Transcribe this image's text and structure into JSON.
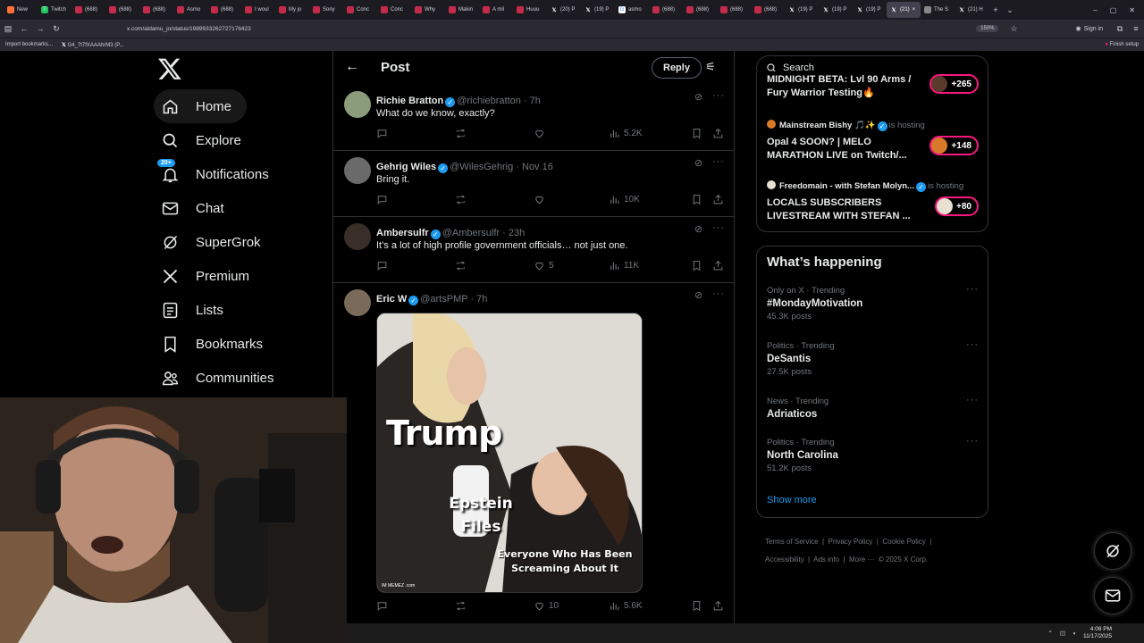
{
  "browser": {
    "tabs": [
      {
        "label": "New",
        "icon": "firefox"
      },
      {
        "label": "Twitch",
        "icon": "twitch"
      },
      {
        "label": "(688)",
        "icon": "youtube"
      },
      {
        "label": "(688)",
        "icon": "youtube"
      },
      {
        "label": "(688)",
        "icon": "youtube"
      },
      {
        "label": "Asmo",
        "icon": "youtube"
      },
      {
        "label": "(688)",
        "icon": "youtube"
      },
      {
        "label": "I woul",
        "icon": "youtube"
      },
      {
        "label": "My jo",
        "icon": "youtube"
      },
      {
        "label": "Sony",
        "icon": "youtube"
      },
      {
        "label": "Conc",
        "icon": "youtube"
      },
      {
        "label": "Conc",
        "icon": "youtube"
      },
      {
        "label": "Why",
        "icon": "youtube"
      },
      {
        "label": "Makin",
        "icon": "youtube"
      },
      {
        "label": "A mil",
        "icon": "youtube"
      },
      {
        "label": "Huuu",
        "icon": "youtube"
      },
      {
        "label": "(20) P",
        "icon": "x"
      },
      {
        "label": "(19) P",
        "icon": "x"
      },
      {
        "label": "asmo",
        "icon": "google"
      },
      {
        "label": "(688)",
        "icon": "youtube"
      },
      {
        "label": "(688)",
        "icon": "youtube"
      },
      {
        "label": "(688)",
        "icon": "youtube"
      },
      {
        "label": "(688)",
        "icon": "youtube"
      },
      {
        "label": "(19) P",
        "icon": "x"
      },
      {
        "label": "(19) P",
        "icon": "x"
      },
      {
        "label": "(19) P",
        "icon": "x"
      },
      {
        "label": "(21)",
        "icon": "x",
        "active": true
      },
      {
        "label": "The S",
        "icon": "other"
      },
      {
        "label": "(21) H",
        "icon": "x"
      }
    ],
    "url": "x.com/aldamu_jo/status/1989933262727176423",
    "zoom": "150%",
    "sign_in": "Sign in",
    "bookmarks": [
      "Import bookmarks...",
      "G4_7t7fXAAAhrM3 (P..."
    ],
    "finish_setup": "Finish setup",
    "clock_time": "4:08 PM",
    "clock_date": "11/17/2025"
  },
  "nav": {
    "items": [
      {
        "id": "home",
        "label": "Home",
        "icon": "home-icon"
      },
      {
        "id": "explore",
        "label": "Explore",
        "icon": "search-icon"
      },
      {
        "id": "notifications",
        "label": "Notifications",
        "icon": "bell-icon",
        "badge": "20+"
      },
      {
        "id": "chat",
        "label": "Chat",
        "icon": "mail-icon"
      },
      {
        "id": "supergrok",
        "label": "SuperGrok",
        "icon": "grok-icon"
      },
      {
        "id": "premium",
        "label": "Premium",
        "icon": "x-logo-icon"
      },
      {
        "id": "lists",
        "label": "Lists",
        "icon": "list-icon"
      },
      {
        "id": "bookmarks",
        "label": "Bookmarks",
        "icon": "bookmark-icon"
      },
      {
        "id": "communities",
        "label": "Communities",
        "icon": "people-icon"
      }
    ]
  },
  "header": {
    "title": "Post",
    "reply_button": "Reply"
  },
  "replies": [
    {
      "name": "Richie Bratton",
      "handle": "@richiebratton",
      "time": "7h",
      "text": "What do we know, exactly?",
      "likes": "",
      "views": "5.2K"
    },
    {
      "name": "Gehrig Wiles",
      "handle": "@WilesGehrig",
      "time": "Nov 16",
      "text": "Bring it.",
      "likes": "",
      "views": "10K"
    },
    {
      "name": "Ambersulfr",
      "handle": "@Ambersulfr",
      "time": "23h",
      "text": "It’s a lot of high profile government officials… not just one.",
      "likes": "5",
      "views": "11K"
    },
    {
      "name": "Eric W",
      "handle": "@artsPMP",
      "time": "7h",
      "text": "",
      "likes": "10",
      "views": "5.6K"
    }
  ],
  "meme": {
    "label_top": "Trump",
    "label_middle": "Epstein Files",
    "label_bottom": "Everyone Who Has Been Screaming About It",
    "watermark": "IM MEMEZ .com"
  },
  "search": {
    "placeholder": "Search"
  },
  "live": [
    {
      "host": "",
      "title": "MIDNIGHT BETA: Lvl 90 Arms / Fury Warrior Testing🔥",
      "count": "+265",
      "hosting": ""
    },
    {
      "host": "Mainstream Bishy 🎵✨",
      "title": "Opal 4 SOON? | MELO MARATHON LIVE on Twitch/...",
      "count": "+148",
      "hosting": "is hosting"
    },
    {
      "host": "Freedomain - with Stefan Molyn...",
      "title": "LOCALS SUBSCRIBERS LIVESTREAM WITH STEFAN ...",
      "count": "+80",
      "hosting": "is hosting"
    }
  ],
  "happening": {
    "title": "What’s happening",
    "trends": [
      {
        "meta": "Only on X · Trending",
        "name": "#MondayMotivation",
        "count": "45.3K posts"
      },
      {
        "meta": "Politics · Trending",
        "name": "DeSantis",
        "count": "27.5K posts"
      },
      {
        "meta": "News · Trending",
        "name": "Adriaticos",
        "count": ""
      },
      {
        "meta": "Politics · Trending",
        "name": "North Carolina",
        "count": "51.2K posts"
      }
    ],
    "show_more": "Show more"
  },
  "footer": {
    "links": [
      "Terms of Service",
      "Privacy Policy",
      "Cookie Policy",
      "Accessibility",
      "Ads info",
      "More ···",
      "© 2025 X Corp."
    ]
  },
  "colors": {
    "accent": "#1d9bf0",
    "live": "#f91880",
    "bg": "#000000",
    "border": "#2f3336"
  }
}
